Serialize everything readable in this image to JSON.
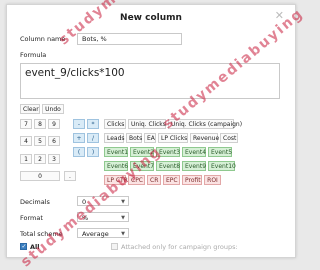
{
  "dialog": {
    "title": "New column",
    "close_icon": "close-icon"
  },
  "column_name": {
    "label": "Column name",
    "value": "Bots, %"
  },
  "formula": {
    "label": "Formula",
    "value": "event_9/clicks*100"
  },
  "editor": {
    "clear_label": "Clear",
    "undo_label": "Undo"
  },
  "keypad": {
    "digits": [
      "7",
      "8",
      "9",
      "4",
      "5",
      "6",
      "1",
      "2",
      "3",
      "0"
    ],
    "dot": ".",
    "operators": [
      "-",
      "*",
      "+",
      "/",
      "(",
      ")"
    ]
  },
  "metrics": {
    "row1": [
      "Clicks",
      "Uniq. Clicks",
      "Uniq. Clicks (campaign)"
    ],
    "row2": [
      "Leads",
      "Bots",
      "EA",
      "LP Clicks",
      "Revenue",
      "Cost"
    ],
    "row3": [
      "Event1",
      "Event2",
      "Event3",
      "Event4",
      "Event5"
    ],
    "row4": [
      "Event6",
      "Event7",
      "Event8",
      "Event9",
      "Event10"
    ],
    "row5": [
      "LP CTR",
      "CPC",
      "CR",
      "EPC",
      "Profit",
      "ROI"
    ]
  },
  "decimals": {
    "label": "Decimals",
    "value": "0"
  },
  "format": {
    "label": "Format",
    "value": "%"
  },
  "total_scheme": {
    "label": "Total scheme",
    "value": "Average"
  },
  "all": {
    "label": "All",
    "checked": true
  },
  "campaign_groups": {
    "label": "Attached only for campaign groups:",
    "checked": false
  },
  "watermark": {
    "text": "studymediabuying"
  }
}
